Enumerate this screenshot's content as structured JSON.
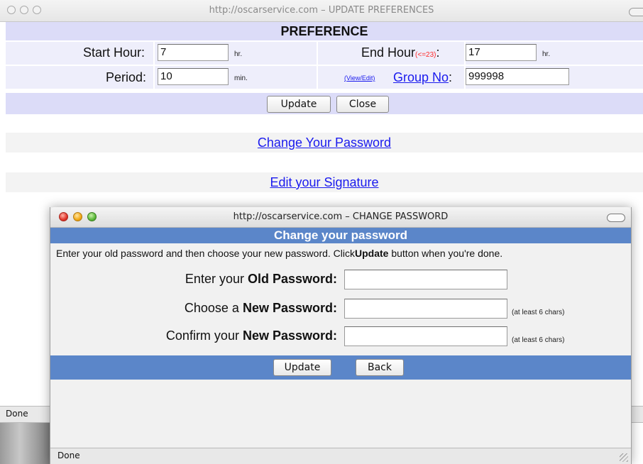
{
  "background_window": {
    "title": "http://oscarservice.com – UPDATE PREFERENCES",
    "heading": "PREFERENCE",
    "start_hour": {
      "label": "Start Hour:",
      "value": "7",
      "unit": "hr."
    },
    "end_hour": {
      "label": "End Hour",
      "hint": "(<=23)",
      "colon": ":",
      "value": "17",
      "unit": "hr."
    },
    "period": {
      "label": "Period:",
      "value": "10",
      "unit": "min."
    },
    "group_no": {
      "view_edit_link": "(View/Edit)",
      "label": "Group No",
      "colon": ":",
      "value": "999998"
    },
    "buttons": {
      "update": "Update",
      "close": "Close"
    },
    "links": {
      "change_password": "Change Your Password",
      "edit_signature": "Edit your Signature"
    },
    "status": "Done"
  },
  "dialog": {
    "title": "http://oscarservice.com – CHANGE PASSWORD",
    "header": "Change your password",
    "instructions_pre": "Enter your old password and then choose your new password. Click",
    "instructions_bold": "Update",
    "instructions_post": " button when you're done.",
    "old_password": {
      "prefix": "Enter your ",
      "bold": "Old Password:",
      "value": ""
    },
    "new_password": {
      "prefix": "Choose a ",
      "bold": "New Password:",
      "value": "",
      "hint": "(at least 6 chars)"
    },
    "confirm_password": {
      "prefix": "Confirm your ",
      "bold": "New Password:",
      "value": "",
      "hint": "(at least 6 chars)"
    },
    "buttons": {
      "update": "Update",
      "back": "Back"
    },
    "status": "Done"
  },
  "colors": {
    "preference_header_bg": "#dcdcf8",
    "preference_row_bg": "#eeeefb",
    "dialog_header_bg": "#5b86c9",
    "link_color": "#1a1aee",
    "hint_red": "#ff2a2a"
  }
}
